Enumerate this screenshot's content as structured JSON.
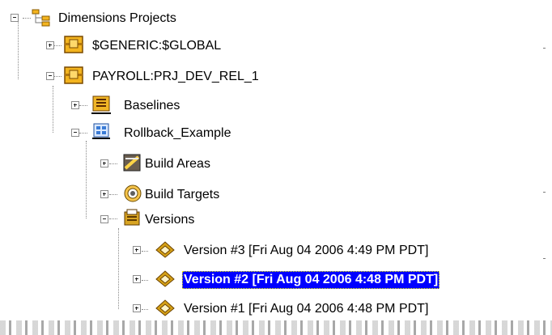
{
  "tree": {
    "root": {
      "label": "Dimensions Projects",
      "icon": "project-tree-root-icon"
    },
    "generic": {
      "label": "$GENERIC:$GLOBAL",
      "icon": "project-folder-icon"
    },
    "payroll": {
      "label": "PAYROLL:PRJ_DEV_REL_1",
      "icon": "project-folder-icon"
    },
    "baselines": {
      "label": "Baselines",
      "icon": "baselines-icon"
    },
    "rollback": {
      "label": "Rollback_Example",
      "icon": "build-project-icon"
    },
    "build_areas": {
      "label": "Build Areas",
      "icon": "build-areas-icon"
    },
    "build_targets": {
      "label": "Build Targets",
      "icon": "build-targets-icon"
    },
    "versions": {
      "label": "Versions",
      "icon": "versions-icon"
    },
    "version3": {
      "label": "Version #3 [Fri Aug 04 2006 4:49 PM PDT]",
      "icon": "version-icon"
    },
    "version2": {
      "label": "Version #2 [Fri Aug 04 2006 4:48 PM PDT]",
      "icon": "version-icon",
      "selected": true
    },
    "version1": {
      "label": "Version #1 [Fri Aug 04 2006 4:48 PM PDT]",
      "icon": "version-icon"
    }
  },
  "colors": {
    "selection_bg": "#0000ff",
    "selection_text": "#ffffff",
    "folder_orange": "#f3b41f",
    "version_gold": "#d6a116"
  }
}
